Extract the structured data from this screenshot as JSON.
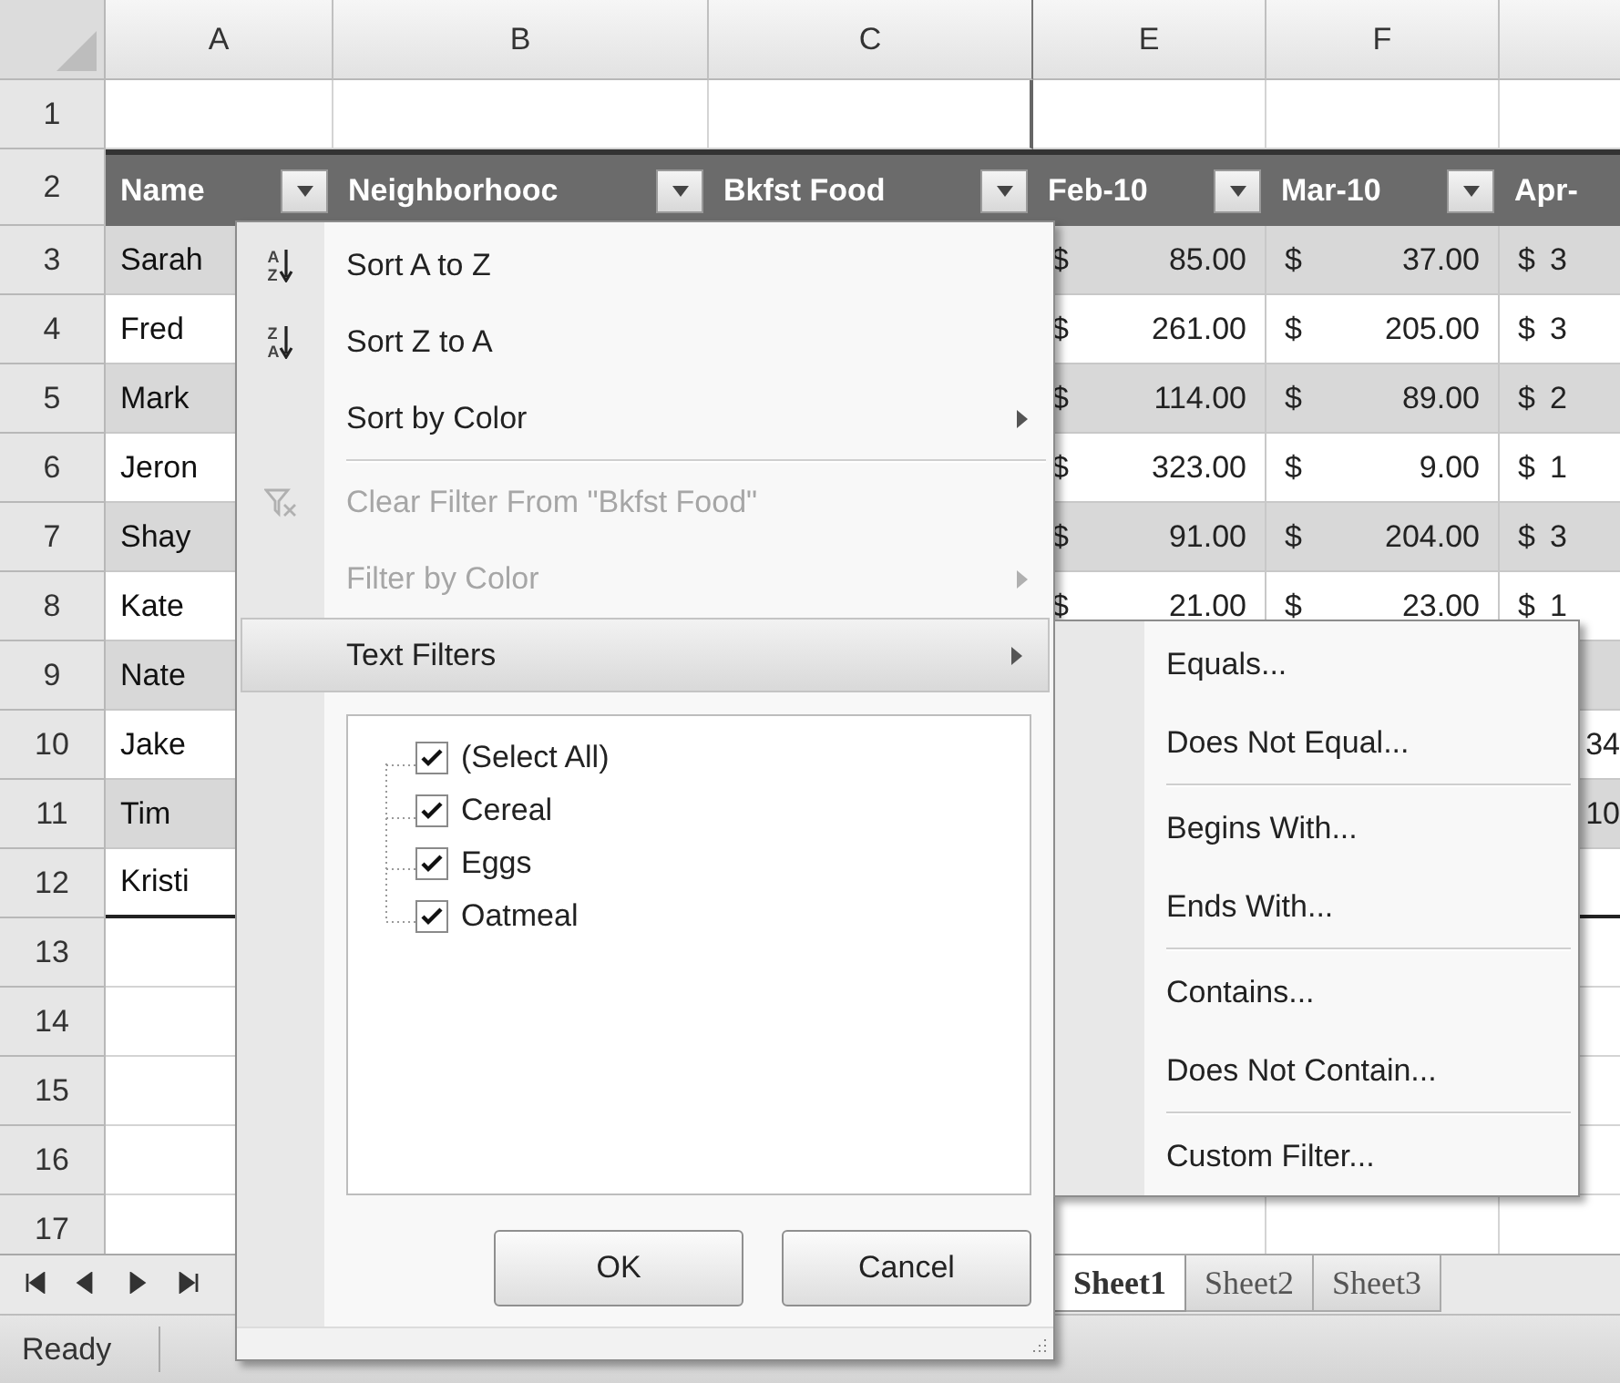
{
  "sheet": {
    "column_letters": [
      "A",
      "B",
      "C",
      "E",
      "F"
    ],
    "rows": [
      {
        "number": "1",
        "kind": "empty"
      },
      {
        "number": "2",
        "kind": "header",
        "cells": [
          {
            "label": "Name",
            "filter_button": true
          },
          {
            "label": "Neighborhooc",
            "filter_button": true
          },
          {
            "label": "Bkfst Food",
            "filter_button": true
          },
          {
            "label": "Feb-10",
            "filter_button": true
          },
          {
            "label": "Mar-10",
            "filter_button": true
          },
          {
            "label": "Apr-",
            "filter_button": false
          }
        ]
      },
      {
        "number": "3",
        "kind": "data",
        "shaded": true,
        "name": "Sarah",
        "feb": {
          "currency": "$",
          "amount": "85.00"
        },
        "mar": {
          "currency": "$",
          "amount": "37.00"
        },
        "apr": {
          "currency": "$",
          "amount": "3"
        }
      },
      {
        "number": "4",
        "kind": "data",
        "shaded": false,
        "name": "Fred",
        "feb": {
          "currency": "$",
          "amount": "261.00"
        },
        "mar": {
          "currency": "$",
          "amount": "205.00"
        },
        "apr": {
          "currency": "$",
          "amount": "3"
        }
      },
      {
        "number": "5",
        "kind": "data",
        "shaded": true,
        "name": "Mark",
        "feb": {
          "currency": "$",
          "amount": "114.00"
        },
        "mar": {
          "currency": "$",
          "amount": "89.00"
        },
        "apr": {
          "currency": "$",
          "amount": "2"
        }
      },
      {
        "number": "6",
        "kind": "data",
        "shaded": false,
        "name": "Jeron",
        "feb": {
          "currency": "$",
          "amount": "323.00"
        },
        "mar": {
          "currency": "$",
          "amount": "9.00"
        },
        "apr": {
          "currency": "$",
          "amount": "1"
        }
      },
      {
        "number": "7",
        "kind": "data",
        "shaded": true,
        "name": "Shay",
        "feb": {
          "currency": "$",
          "amount": "91.00"
        },
        "mar": {
          "currency": "$",
          "amount": "204.00"
        },
        "apr": {
          "currency": "$",
          "amount": "3"
        }
      },
      {
        "number": "8",
        "kind": "data",
        "shaded": false,
        "name": "Kate",
        "feb": {
          "currency": "$",
          "amount": "21.00"
        },
        "mar": {
          "currency": "$",
          "amount": "23.00"
        },
        "apr": {
          "currency": "$",
          "amount": "1"
        }
      },
      {
        "number": "9",
        "kind": "data",
        "shaded": true,
        "name": "Nate"
      },
      {
        "number": "10",
        "kind": "data",
        "shaded": false,
        "name": "Jake",
        "apr": {
          "amount": "34"
        }
      },
      {
        "number": "11",
        "kind": "data",
        "shaded": true,
        "name": "Tim",
        "apr": {
          "amount": "10"
        }
      },
      {
        "number": "12",
        "kind": "data",
        "shaded": false,
        "name": "Kristi"
      },
      {
        "number": "13",
        "kind": "empty"
      },
      {
        "number": "14",
        "kind": "empty"
      },
      {
        "number": "15",
        "kind": "empty"
      },
      {
        "number": "16",
        "kind": "empty"
      },
      {
        "number": "17",
        "kind": "empty"
      }
    ]
  },
  "filter_menu": {
    "items": [
      {
        "kind": "sort",
        "label": "Sort A to Z",
        "icon_letters": [
          "A",
          "Z"
        ],
        "disabled": false,
        "selected": false,
        "submenu": false
      },
      {
        "kind": "sort",
        "label": "Sort Z to A",
        "icon_letters": [
          "Z",
          "A"
        ],
        "disabled": false,
        "selected": false,
        "submenu": false
      },
      {
        "kind": "command",
        "label": "Sort by Color",
        "disabled": false,
        "selected": false,
        "submenu": true
      },
      {
        "kind": "separator"
      },
      {
        "kind": "clear",
        "label": "Clear Filter From \"Bkfst Food\"",
        "disabled": true,
        "selected": false,
        "submenu": false
      },
      {
        "kind": "command",
        "label": "Filter by Color",
        "disabled": true,
        "selected": false,
        "submenu": true
      },
      {
        "kind": "command",
        "label": "Text Filters",
        "disabled": false,
        "selected": true,
        "submenu": true
      }
    ],
    "values": [
      {
        "label": "(Select All)",
        "checked": true
      },
      {
        "label": "Cereal",
        "checked": true
      },
      {
        "label": "Eggs",
        "checked": true
      },
      {
        "label": "Oatmeal",
        "checked": true
      }
    ],
    "buttons": [
      "OK",
      "Cancel"
    ]
  },
  "text_filters_menu": {
    "items": [
      {
        "kind": "command",
        "label": "Equals..."
      },
      {
        "kind": "command",
        "label": "Does Not Equal..."
      },
      {
        "kind": "separator"
      },
      {
        "kind": "command",
        "label": "Begins With..."
      },
      {
        "kind": "command",
        "label": "Ends With..."
      },
      {
        "kind": "separator"
      },
      {
        "kind": "command",
        "label": "Contains..."
      },
      {
        "kind": "command",
        "label": "Does Not Contain..."
      },
      {
        "kind": "separator"
      },
      {
        "kind": "command",
        "label": "Custom Filter..."
      }
    ]
  },
  "sheet_tabs": [
    {
      "label": "Sheet1",
      "selected": true
    },
    {
      "label": "Sheet2",
      "selected": false
    },
    {
      "label": "Sheet3",
      "selected": false
    }
  ],
  "status_bar": {
    "text": "Ready"
  }
}
